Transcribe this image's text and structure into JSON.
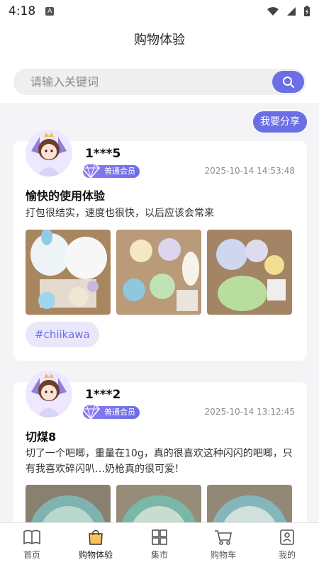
{
  "status": {
    "time": "4:18",
    "notif_letter": "A"
  },
  "header": {
    "title": "购物体验"
  },
  "search": {
    "placeholder": "请输入关键词"
  },
  "share_label": "我要分享",
  "posts": [
    {
      "user": "1***5",
      "level": "普通会员",
      "time": "2025-10-14 14:53:48",
      "title": "愉快的使用体验",
      "text": "打包很结实，速度也很快，以后应该会常来",
      "tag": "#chiikawa"
    },
    {
      "user": "1***2",
      "level": "普通会员",
      "time": "2025-10-14 13:12:45",
      "title": "切煤8",
      "text": "切了一个吧唧，重量在10g，真的很喜欢这种闪闪的吧唧，只有我喜欢碎闪叭…奶枪真的很可爱！"
    }
  ],
  "tabs": [
    {
      "label": "首页",
      "icon": "home-icon"
    },
    {
      "label": "购物体验",
      "icon": "shopping-bag-icon"
    },
    {
      "label": "集市",
      "icon": "grid-icon"
    },
    {
      "label": "购物车",
      "icon": "cart-icon"
    },
    {
      "label": "我的",
      "icon": "profile-icon"
    }
  ],
  "colors": {
    "accent": "#6c6ee6",
    "tag_bg": "#ebe7fb",
    "page_bg": "#f4f4f6"
  }
}
